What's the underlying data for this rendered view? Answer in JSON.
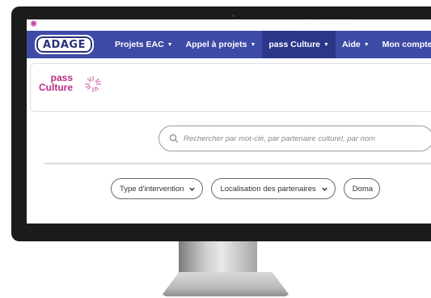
{
  "top_bar": {
    "user_info": "·· ·· · · ··· ·· ·· ··"
  },
  "navbar": {
    "logo": "ADAGE",
    "items": [
      {
        "label": "Projets EAC",
        "caret": "▼"
      },
      {
        "label": "Appel à projets",
        "caret": "▼"
      },
      {
        "label": "pass Culture",
        "caret": "▼",
        "active": true
      },
      {
        "label": "Aide",
        "caret": "▼"
      },
      {
        "label": "Mon compte",
        "caret": ""
      }
    ],
    "accent": "#3d4aa6",
    "active_bg": "#2c3688"
  },
  "brand": {
    "line1": "pass",
    "line2": "Culture",
    "color": "#b92c83"
  },
  "search": {
    "placeholder": "Rechercher par mot-clé, par partenaire culturel, par nom",
    "icon": "search-icon"
  },
  "filters": [
    {
      "label": "Type d'intervention",
      "icon": "chevron-down-icon"
    },
    {
      "label": "Localisation des partenaires",
      "icon": "chevron-down-icon"
    },
    {
      "label": "Doma",
      "icon": "chevron-down-icon"
    }
  ]
}
